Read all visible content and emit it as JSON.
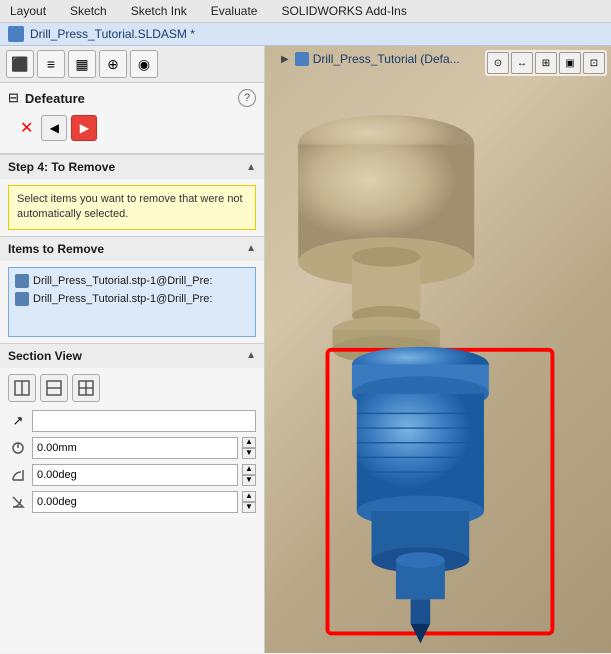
{
  "menubar": {
    "items": [
      "Layout",
      "Sketch",
      "Sketch Ink",
      "Evaluate",
      "SOLIDWORKS Add-Ins"
    ]
  },
  "titlebar": {
    "filename": "Drill_Press_Tutorial.SLDASM *"
  },
  "toolbar": {
    "buttons": [
      {
        "name": "cube-icon",
        "symbol": "⬛"
      },
      {
        "name": "list-icon",
        "symbol": "☰"
      },
      {
        "name": "feature-icon",
        "symbol": "▦"
      },
      {
        "name": "target-icon",
        "symbol": "⊕"
      },
      {
        "name": "render-icon",
        "symbol": "◉"
      }
    ]
  },
  "feature_panel": {
    "title": "Defeature",
    "help_label": "?",
    "close_label": "✕",
    "back_label": "◀",
    "forward_label": "▶"
  },
  "step4": {
    "header": "Step 4: To Remove",
    "info_text": "Select items you want to remove that were not automatically selected."
  },
  "items_to_remove": {
    "header": "Items to Remove",
    "items": [
      {
        "text": "Drill_Press_Tutorial.stp-1@Drill_Pre:"
      },
      {
        "text": "Drill_Press_Tutorial.stp-1@Drill_Pre:"
      }
    ]
  },
  "section_view": {
    "header": "Section View",
    "buttons": [
      {
        "name": "sv-btn-1",
        "symbol": "⊟"
      },
      {
        "name": "sv-btn-2",
        "symbol": "⊟"
      },
      {
        "name": "sv-btn-3",
        "symbol": "⊞"
      }
    ],
    "fields": [
      {
        "icon": "↗",
        "value": "",
        "placeholder": ""
      },
      {
        "icon": "⊙",
        "value": "0.00mm"
      },
      {
        "icon": "↻",
        "value": "0.00deg"
      },
      {
        "icon": "↺",
        "value": "0.00deg"
      }
    ]
  },
  "viewport": {
    "tree_label": "Drill_Press_Tutorial (Defa..."
  }
}
